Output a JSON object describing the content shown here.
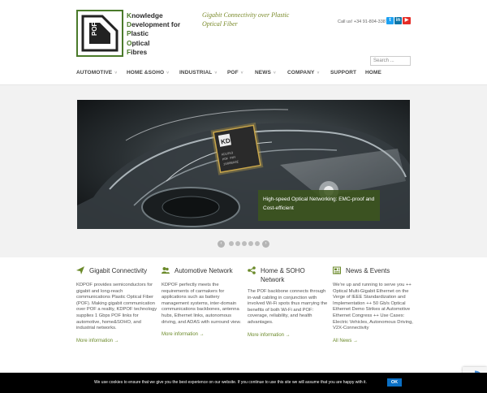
{
  "logo": {
    "lines": [
      {
        "cap": "K",
        "rest": "nowledge"
      },
      {
        "cap": "D",
        "rest": "evelopment for"
      },
      {
        "cap": "P",
        "rest": "lastic"
      },
      {
        "cap": "O",
        "rest": "ptical"
      },
      {
        "cap": "F",
        "rest": "ibres"
      }
    ],
    "mark_text": "POF",
    "brand_color": "#4a7a2a"
  },
  "tagline": "Gigabit Connectivity over Plastic Optical Fiber",
  "contact": {
    "call_us": "Call us! +34 91-804-3387"
  },
  "social": [
    {
      "icon": "twitter-icon",
      "glyph": "t",
      "color": "#1da1f2"
    },
    {
      "icon": "linkedin-icon",
      "glyph": "in",
      "color": "#0e76a8"
    },
    {
      "icon": "youtube-icon",
      "glyph": "▶",
      "color": "#e52d27"
    }
  ],
  "search": {
    "placeholder": "Search ..."
  },
  "nav": [
    {
      "label": "AUTOMOTIVE",
      "dropdown": true
    },
    {
      "label": "HOME &SOHO",
      "dropdown": true
    },
    {
      "label": "INDUSTRIAL",
      "dropdown": true
    },
    {
      "label": "POF",
      "dropdown": true
    },
    {
      "label": "NEWS",
      "dropdown": true
    },
    {
      "label": "COMPANY",
      "dropdown": true
    },
    {
      "label": "SUPPORT",
      "dropdown": false
    },
    {
      "label": "HOME",
      "dropdown": false
    }
  ],
  "slider": {
    "caption": "High-speed Optical Networking: EMC-proof and Cost-efficient",
    "chip_text": "KD",
    "slide_count": 5,
    "prev_glyph": "‹",
    "next_glyph": "›"
  },
  "features": [
    {
      "icon": "paper-plane-icon",
      "title": "Gigabit Connectivity",
      "body": "KDPOF provides semiconductors for gigabit and long-reach communications Plastic Optical Fiber (POF). Making gigabit communication over POF a reality, KDPOF technology supplies 1 Gbps POF links for automotive, home&SOHO, and industrial networks.",
      "link": "More information →"
    },
    {
      "icon": "users-icon",
      "title": "Automotive Network",
      "body": "KDPOF perfectly meets the requirements of carmakers for applications such as battery management systems, inter-domain communications backbones, antenna hubs, Ethernet links, autonomous driving, and ADAS with surround view.",
      "link": "More information →"
    },
    {
      "icon": "share-icon",
      "title": "Home & SOHO Network",
      "body": "The POF backbone connects through in-wall cabling in conjunction with involved Wi-Fi spots thus marrying the benefits of both Wi-Fi and POF: coverage, reliability, and health advantages.",
      "link": "More information →"
    },
    {
      "icon": "news-icon",
      "title": "News & Events",
      "body": "We're up and running to serve you ++ Optical Multi-Gigabit Ethernet on the Verge of IEEE Standardization and Implementation ++ 50 Gb/s Optical Ethernet Demo Strikes at Automotive Ethernet Congress ++ Use Cases: Electric Vehicles, Autonomous Driving, V2X-Connectivity",
      "link": "All News →"
    }
  ],
  "cookie": {
    "text": "We use cookies to ensure that we give you the best experience on our website. If you continue to use this site we will assume that you are happy with it.",
    "ok_label": "OK"
  },
  "colors": {
    "accent": "#6b8a2a",
    "nav_text": "#444444",
    "cookie_ok": "#0a6fc4"
  }
}
